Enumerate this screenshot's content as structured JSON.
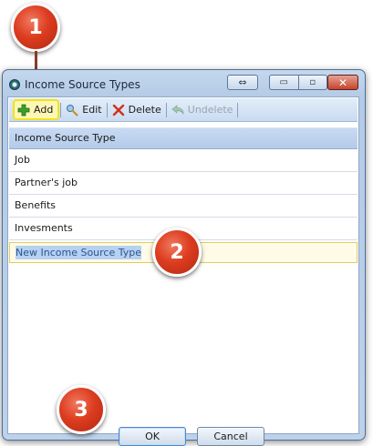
{
  "window": {
    "title": "Income Source Types",
    "restore_glyph": "⇔",
    "minimize_glyph": "▭",
    "maximize_glyph": "▫",
    "close_glyph": "✕"
  },
  "toolbar": {
    "add_label": "Add",
    "edit_label": "Edit",
    "delete_label": "Delete",
    "undelete_label": "Undelete"
  },
  "grid": {
    "column_header": "Income Source Type",
    "rows": [
      "Job",
      "Partner's job",
      "Benefits",
      "Invesments"
    ],
    "new_row_value": "New Income Source Type"
  },
  "buttons": {
    "ok_label": "OK",
    "cancel_label": "Cancel"
  },
  "callouts": {
    "step1": "1",
    "step2": "2",
    "step3": "3"
  },
  "colors": {
    "highlight": "#f1e31b",
    "badge": "#dd3c1f",
    "selection": "#b6d1f1"
  }
}
